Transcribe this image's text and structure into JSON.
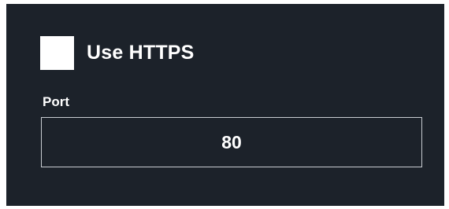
{
  "https": {
    "label": "Use HTTPS",
    "checked": false
  },
  "port": {
    "label": "Port",
    "value": "80"
  },
  "colors": {
    "panel_background": "#1c222a",
    "text": "#ffffff",
    "input_border": "#c8ccd2",
    "checkbox_fill": "#ffffff"
  }
}
